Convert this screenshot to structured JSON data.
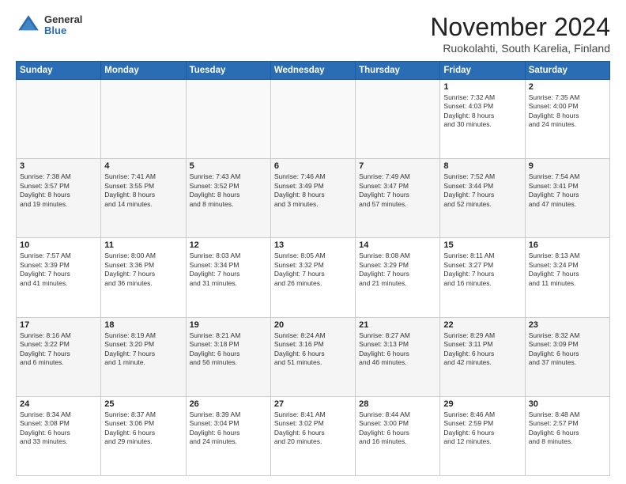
{
  "header": {
    "logo_general": "General",
    "logo_blue": "Blue",
    "month_title": "November 2024",
    "subtitle": "Ruokolahti, South Karelia, Finland"
  },
  "weekdays": [
    "Sunday",
    "Monday",
    "Tuesday",
    "Wednesday",
    "Thursday",
    "Friday",
    "Saturday"
  ],
  "weeks": [
    [
      {
        "day": "",
        "info": ""
      },
      {
        "day": "",
        "info": ""
      },
      {
        "day": "",
        "info": ""
      },
      {
        "day": "",
        "info": ""
      },
      {
        "day": "",
        "info": ""
      },
      {
        "day": "1",
        "info": "Sunrise: 7:32 AM\nSunset: 4:03 PM\nDaylight: 8 hours\nand 30 minutes."
      },
      {
        "day": "2",
        "info": "Sunrise: 7:35 AM\nSunset: 4:00 PM\nDaylight: 8 hours\nand 24 minutes."
      }
    ],
    [
      {
        "day": "3",
        "info": "Sunrise: 7:38 AM\nSunset: 3:57 PM\nDaylight: 8 hours\nand 19 minutes."
      },
      {
        "day": "4",
        "info": "Sunrise: 7:41 AM\nSunset: 3:55 PM\nDaylight: 8 hours\nand 14 minutes."
      },
      {
        "day": "5",
        "info": "Sunrise: 7:43 AM\nSunset: 3:52 PM\nDaylight: 8 hours\nand 8 minutes."
      },
      {
        "day": "6",
        "info": "Sunrise: 7:46 AM\nSunset: 3:49 PM\nDaylight: 8 hours\nand 3 minutes."
      },
      {
        "day": "7",
        "info": "Sunrise: 7:49 AM\nSunset: 3:47 PM\nDaylight: 7 hours\nand 57 minutes."
      },
      {
        "day": "8",
        "info": "Sunrise: 7:52 AM\nSunset: 3:44 PM\nDaylight: 7 hours\nand 52 minutes."
      },
      {
        "day": "9",
        "info": "Sunrise: 7:54 AM\nSunset: 3:41 PM\nDaylight: 7 hours\nand 47 minutes."
      }
    ],
    [
      {
        "day": "10",
        "info": "Sunrise: 7:57 AM\nSunset: 3:39 PM\nDaylight: 7 hours\nand 41 minutes."
      },
      {
        "day": "11",
        "info": "Sunrise: 8:00 AM\nSunset: 3:36 PM\nDaylight: 7 hours\nand 36 minutes."
      },
      {
        "day": "12",
        "info": "Sunrise: 8:03 AM\nSunset: 3:34 PM\nDaylight: 7 hours\nand 31 minutes."
      },
      {
        "day": "13",
        "info": "Sunrise: 8:05 AM\nSunset: 3:32 PM\nDaylight: 7 hours\nand 26 minutes."
      },
      {
        "day": "14",
        "info": "Sunrise: 8:08 AM\nSunset: 3:29 PM\nDaylight: 7 hours\nand 21 minutes."
      },
      {
        "day": "15",
        "info": "Sunrise: 8:11 AM\nSunset: 3:27 PM\nDaylight: 7 hours\nand 16 minutes."
      },
      {
        "day": "16",
        "info": "Sunrise: 8:13 AM\nSunset: 3:24 PM\nDaylight: 7 hours\nand 11 minutes."
      }
    ],
    [
      {
        "day": "17",
        "info": "Sunrise: 8:16 AM\nSunset: 3:22 PM\nDaylight: 7 hours\nand 6 minutes."
      },
      {
        "day": "18",
        "info": "Sunrise: 8:19 AM\nSunset: 3:20 PM\nDaylight: 7 hours\nand 1 minute."
      },
      {
        "day": "19",
        "info": "Sunrise: 8:21 AM\nSunset: 3:18 PM\nDaylight: 6 hours\nand 56 minutes."
      },
      {
        "day": "20",
        "info": "Sunrise: 8:24 AM\nSunset: 3:16 PM\nDaylight: 6 hours\nand 51 minutes."
      },
      {
        "day": "21",
        "info": "Sunrise: 8:27 AM\nSunset: 3:13 PM\nDaylight: 6 hours\nand 46 minutes."
      },
      {
        "day": "22",
        "info": "Sunrise: 8:29 AM\nSunset: 3:11 PM\nDaylight: 6 hours\nand 42 minutes."
      },
      {
        "day": "23",
        "info": "Sunrise: 8:32 AM\nSunset: 3:09 PM\nDaylight: 6 hours\nand 37 minutes."
      }
    ],
    [
      {
        "day": "24",
        "info": "Sunrise: 8:34 AM\nSunset: 3:08 PM\nDaylight: 6 hours\nand 33 minutes."
      },
      {
        "day": "25",
        "info": "Sunrise: 8:37 AM\nSunset: 3:06 PM\nDaylight: 6 hours\nand 29 minutes."
      },
      {
        "day": "26",
        "info": "Sunrise: 8:39 AM\nSunset: 3:04 PM\nDaylight: 6 hours\nand 24 minutes."
      },
      {
        "day": "27",
        "info": "Sunrise: 8:41 AM\nSunset: 3:02 PM\nDaylight: 6 hours\nand 20 minutes."
      },
      {
        "day": "28",
        "info": "Sunrise: 8:44 AM\nSunset: 3:00 PM\nDaylight: 6 hours\nand 16 minutes."
      },
      {
        "day": "29",
        "info": "Sunrise: 8:46 AM\nSunset: 2:59 PM\nDaylight: 6 hours\nand 12 minutes."
      },
      {
        "day": "30",
        "info": "Sunrise: 8:48 AM\nSunset: 2:57 PM\nDaylight: 6 hours\nand 8 minutes."
      }
    ]
  ]
}
